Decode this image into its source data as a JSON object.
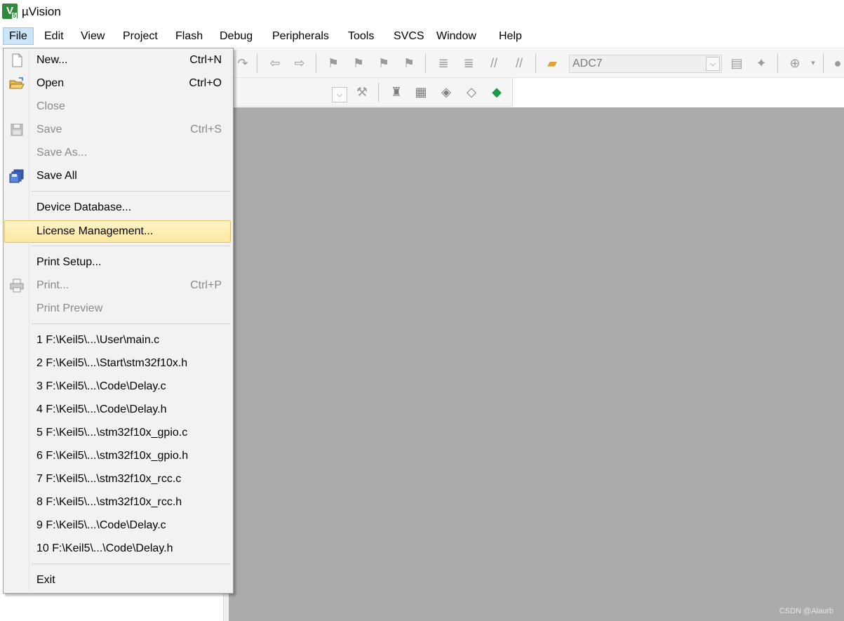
{
  "window": {
    "title": "µVision",
    "logo_text": "V",
    "logo_badge": "5"
  },
  "menubar": {
    "items": [
      {
        "label": "File"
      },
      {
        "label": "Edit"
      },
      {
        "label": "View"
      },
      {
        "label": "Project"
      },
      {
        "label": "Flash"
      },
      {
        "label": "Debug"
      },
      {
        "label": "Peripherals"
      },
      {
        "label": "Tools"
      },
      {
        "label": "SVCS"
      },
      {
        "label": "Window"
      },
      {
        "label": "Help"
      }
    ],
    "active": "File"
  },
  "toolbar": {
    "target_name": "ADC7"
  },
  "file_menu": {
    "items": [
      {
        "label": "New...",
        "shortcut": "Ctrl+N",
        "icon": "new-file-icon"
      },
      {
        "label": "Open",
        "shortcut": "Ctrl+O",
        "icon": "open-folder-icon"
      },
      {
        "label": "Close",
        "shortcut": ""
      },
      {
        "label": "Save",
        "shortcut": "Ctrl+S",
        "icon": "save-icon"
      },
      {
        "label": "Save As...",
        "shortcut": ""
      },
      {
        "label": "Save All",
        "shortcut": "",
        "icon": "save-all-icon"
      },
      {
        "label": "Device Database...",
        "shortcut": ""
      },
      {
        "label": "License Management...",
        "shortcut": ""
      },
      {
        "label": "Print Setup...",
        "shortcut": ""
      },
      {
        "label": "Print...",
        "shortcut": "Ctrl+P",
        "icon": "print-icon"
      },
      {
        "label": "Print Preview",
        "shortcut": ""
      },
      {
        "label": "1 F:\\Keil5\\...\\User\\main.c"
      },
      {
        "label": "2 F:\\Keil5\\...\\Start\\stm32f10x.h"
      },
      {
        "label": "3 F:\\Keil5\\...\\Code\\Delay.c"
      },
      {
        "label": "4 F:\\Keil5\\...\\Code\\Delay.h"
      },
      {
        "label": "5 F:\\Keil5\\...\\stm32f10x_gpio.c"
      },
      {
        "label": "6 F:\\Keil5\\...\\stm32f10x_gpio.h"
      },
      {
        "label": "7 F:\\Keil5\\...\\stm32f10x_rcc.c"
      },
      {
        "label": "8 F:\\Keil5\\...\\stm32f10x_rcc.h"
      },
      {
        "label": "9 F:\\Keil5\\...\\Code\\Delay.c"
      },
      {
        "label": "10 F:\\Keil5\\...\\Code\\Delay.h"
      },
      {
        "label": "Exit"
      }
    ],
    "disabled": [
      "Close",
      "Save",
      "Save As...",
      "Print...",
      "Print Preview"
    ],
    "highlighted": "License Management..."
  },
  "watermark": "CSDN @Alaurb",
  "colors": {
    "workspace": "#ababab",
    "highlight": "#fde8a0",
    "menu_active": "#cce4f7",
    "logo": "#2e8b3a"
  }
}
